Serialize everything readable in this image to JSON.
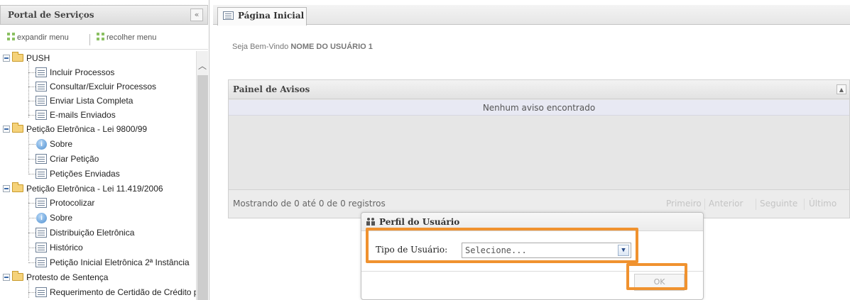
{
  "sidebar": {
    "title": "Portal de Serviços",
    "collapse_glyph": "«",
    "expand_label": "expandir menu",
    "collapse_label": "recolher menu",
    "tree": [
      {
        "label": "PUSH",
        "type": "folder"
      },
      {
        "label": "Incluir Processos",
        "type": "doc"
      },
      {
        "label": "Consultar/Excluir Processos",
        "type": "doc"
      },
      {
        "label": "Enviar Lista Completa",
        "type": "doc"
      },
      {
        "label": "E-mails Enviados",
        "type": "doc"
      },
      {
        "label": "Petição Eletrônica - Lei 9800/99",
        "type": "folder"
      },
      {
        "label": "Sobre",
        "type": "info"
      },
      {
        "label": "Criar Petição",
        "type": "doc"
      },
      {
        "label": "Petições Enviadas",
        "type": "doc"
      },
      {
        "label": "Petição Eletrônica - Lei 11.419/2006",
        "type": "folder"
      },
      {
        "label": "Protocolizar",
        "type": "doc"
      },
      {
        "label": "Sobre",
        "type": "info"
      },
      {
        "label": "Distribuição Eletrônica",
        "type": "doc"
      },
      {
        "label": "Histórico",
        "type": "doc"
      },
      {
        "label": "Petição Inicial Eletrônica 2ª Instância",
        "type": "doc"
      },
      {
        "label": "Protesto de Sentença",
        "type": "folder"
      },
      {
        "label": "Requerimento de Certidão de Crédito p",
        "type": "doc"
      }
    ]
  },
  "tabs": {
    "home_label": "Página Inicial"
  },
  "welcome": {
    "prefix": "Seja Bem-Vindo",
    "user": "NOME DO USUÁRIO 1"
  },
  "notices": {
    "title": "Painel de Avisos",
    "empty_text": "Nenhum aviso encontrado",
    "showing_text": "Mostrando de 0 até 0 de 0 registros",
    "pager": {
      "first": "Primeiro",
      "prev": "Anterior",
      "next": "Seguinte",
      "last": "Último"
    }
  },
  "dialog": {
    "title": "Perfil do Usuário",
    "field_label": "Tipo de Usuário:",
    "select_value": "Selecione...",
    "ok_label": "OK"
  },
  "colors": {
    "highlight": "#f0922f",
    "folder": "#f5d27a"
  }
}
